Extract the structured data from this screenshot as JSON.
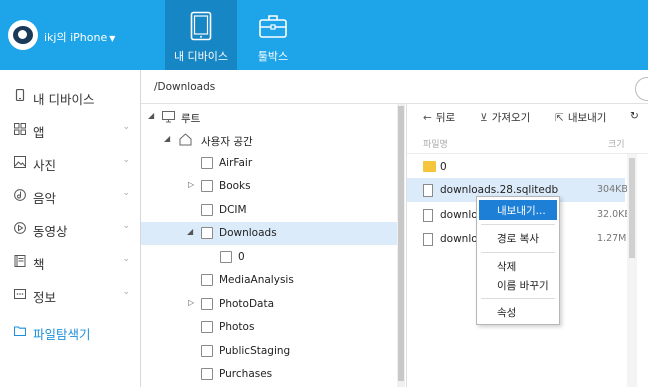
{
  "header": {
    "device_name": "ikj의 iPhone",
    "tabs": [
      {
        "label": "내 디바이스",
        "icon": "tablet-icon",
        "active": true
      },
      {
        "label": "툴박스",
        "icon": "toolbox-icon",
        "active": false
      }
    ],
    "colors": {
      "bar": "#1ea4e9",
      "active_tab": "#1686c4"
    }
  },
  "sidebar": {
    "items": [
      {
        "label": "내 디바이스",
        "icon": "phone-icon",
        "chevron": false
      },
      {
        "label": "앱",
        "icon": "apps-grid-icon",
        "chevron": true
      },
      {
        "label": "사진",
        "icon": "photo-icon",
        "chevron": true
      },
      {
        "label": "음악",
        "icon": "music-icon",
        "chevron": true
      },
      {
        "label": "동영상",
        "icon": "video-icon",
        "chevron": true
      },
      {
        "label": "책",
        "icon": "book-icon",
        "chevron": true
      },
      {
        "label": "정보",
        "icon": "info-icon",
        "chevron": true
      },
      {
        "label": "파일탐색기",
        "icon": "folder-icon",
        "chevron": false,
        "active": true
      }
    ]
  },
  "path": {
    "current": "/Downloads"
  },
  "tree": {
    "rows": [
      {
        "label": "루트",
        "expanded": true
      },
      {
        "label": "사용자 공간",
        "expanded": true
      },
      {
        "label": "AirFair",
        "expandable": false
      },
      {
        "label": "Books",
        "expandable": true
      },
      {
        "label": "DCIM",
        "expandable": false
      },
      {
        "label": "Downloads",
        "expanded": true,
        "selected": true
      },
      {
        "label": "0",
        "expandable": false
      },
      {
        "label": "MediaAnalysis",
        "expandable": false
      },
      {
        "label": "PhotoData",
        "expandable": true
      },
      {
        "label": "Photos",
        "expandable": false
      },
      {
        "label": "PublicStaging",
        "expandable": false
      },
      {
        "label": "Purchases",
        "expandable": false
      }
    ]
  },
  "toolbar": {
    "back": "뒤로",
    "import": "가져오기",
    "export": "내보내기"
  },
  "columns": {
    "name": "파일명",
    "size": "크기"
  },
  "files": [
    {
      "name": "0",
      "type": "folder",
      "size": ""
    },
    {
      "name": "downloads.28.sqlitedb",
      "type": "file",
      "size": "304KB",
      "selected": true
    },
    {
      "name": "downloa",
      "type": "file",
      "size": "32.0KB"
    },
    {
      "name": "downloa",
      "type": "file",
      "size": "1.27MB"
    }
  ],
  "context_menu": {
    "items": [
      {
        "label": "내보내기...",
        "highlighted": true
      },
      {
        "label": "경로 복사"
      },
      {
        "label": "삭제"
      },
      {
        "label": "이름 바꾸기"
      },
      {
        "label": "속성"
      }
    ]
  },
  "accent_color": "#1e8fd8",
  "selection_color": "#dcebfa"
}
